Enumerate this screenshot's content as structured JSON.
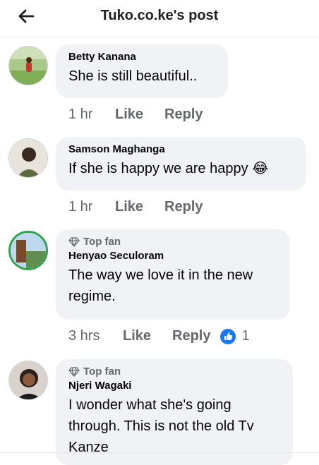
{
  "header": {
    "title": "Tuko.co.ke's post",
    "back_icon": "arrow-left-icon"
  },
  "colors": {
    "accent": "#1877f2",
    "bubble": "#f0f2f5",
    "meta": "#65676b",
    "ring": "#31a24c"
  },
  "comments": [
    {
      "author": "Betty Kanana",
      "text": "She is still beautiful..",
      "top_fan": "",
      "time": "1 hr",
      "like_label": "Like",
      "reply_label": "Reply",
      "reaction_count": ""
    },
    {
      "author": "Samson Maghanga",
      "text": "If she is happy we are happy",
      "emoji": "😂",
      "top_fan": "",
      "time": "1 hr",
      "like_label": "Like",
      "reply_label": "Reply",
      "reaction_count": ""
    },
    {
      "author": "Henyao Seculoram",
      "text": "The way we love it in the new regime.",
      "top_fan": "Top fan",
      "time": "3 hrs",
      "like_label": "Like",
      "reply_label": "Reply",
      "reaction_count": "1"
    },
    {
      "author": "Njeri Wagaki",
      "text": "I wonder what she's going through. This is not the old Tv Kanze",
      "top_fan": "Top fan"
    }
  ]
}
